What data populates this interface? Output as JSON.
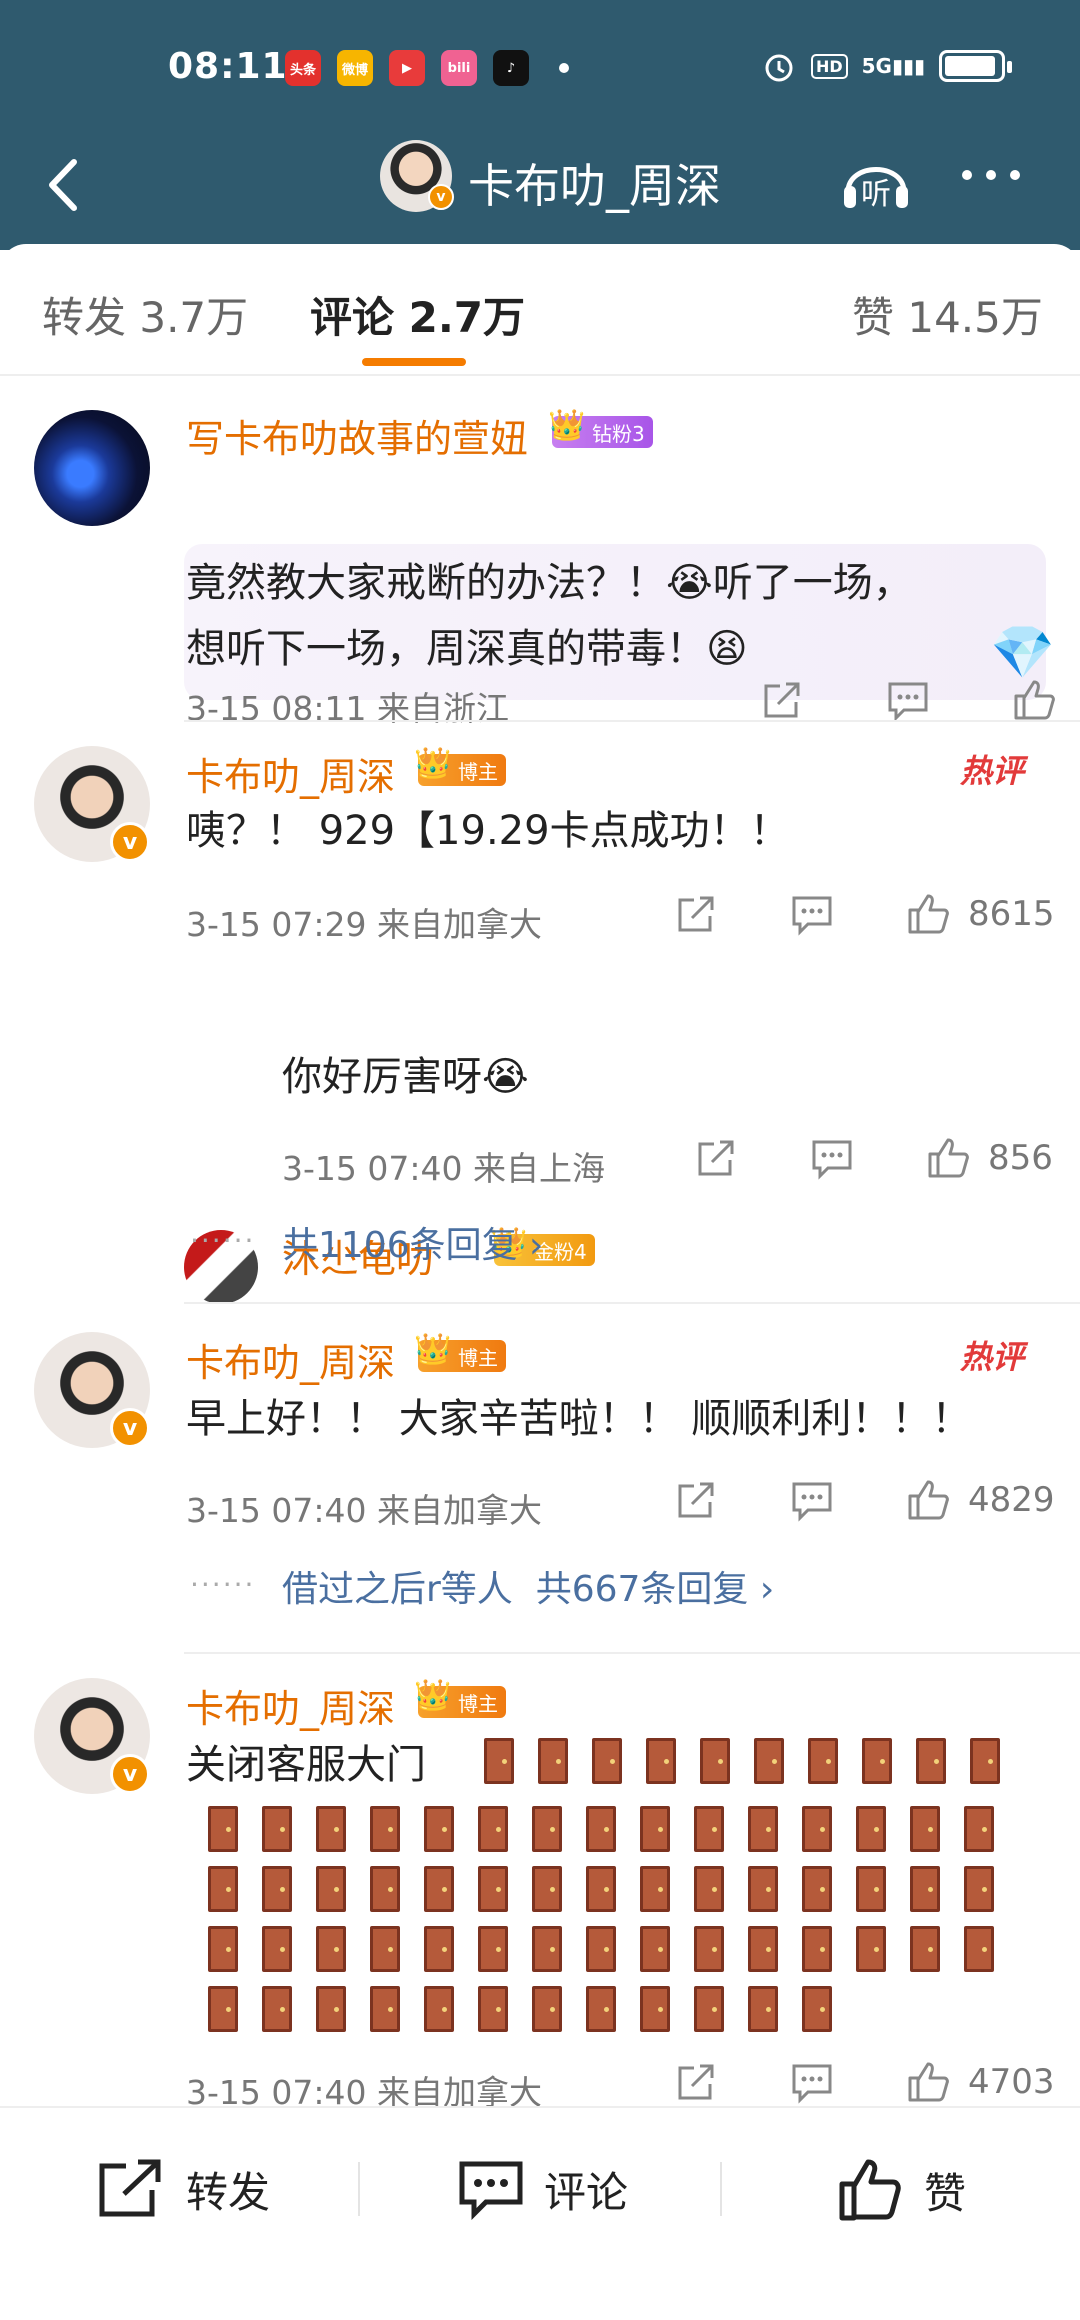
{
  "status": {
    "time": "08:11",
    "app_icons": [
      "头条",
      "微博",
      "▶",
      "bili",
      "♪"
    ],
    "net": "5G",
    "hd": "HD"
  },
  "nav": {
    "title": "卡布叻_周深"
  },
  "tabs": [
    {
      "label": "转发 3.7万"
    },
    {
      "label": "评论 2.7万"
    },
    {
      "label": "赞 14.5万"
    }
  ],
  "comments": [
    {
      "name": "写卡布叻故事的萱妞",
      "badge": "钻粉3",
      "line1": "竟然教大家戒断的办法？！😭听了一场，",
      "line2": "想听下一场，周深真的带毒！😫",
      "meta": "3-15 08:11  来自浙江"
    },
    {
      "name": "卡布叻_周深",
      "badge": "博主",
      "hot": "热评",
      "text": "咦？！ 929【19.29卡点成功！！",
      "meta": "3-15 07:29  来自加拿大",
      "likes": "8615",
      "reply": {
        "name": "沐尐龟叻",
        "badge": "金粉4",
        "text": "你好厉害呀😭",
        "meta": "3-15 07:40  来自上海",
        "likes": "856"
      },
      "replies_link": "共1106条回复 ›"
    },
    {
      "name": "卡布叻_周深",
      "badge": "博主",
      "hot": "热评",
      "text": "早上好！！ 大家辛苦啦！！ 顺顺利利！！！",
      "meta": "3-15 07:40  来自加拿大",
      "likes": "4829",
      "replied_by": "借过之后r等人",
      "replies_link": "共667条回复 ›"
    },
    {
      "name": "卡布叻_周深",
      "badge": "博主",
      "text": "关闭客服大门",
      "meta": "3-15 07:40  来自加拿大",
      "likes": "4703"
    }
  ],
  "bottom": {
    "repost": "转发",
    "comment": "评论",
    "like": "赞"
  },
  "colors": {
    "header": "#2f5a6e",
    "accent": "#f57c00",
    "name": "#e46e00",
    "link": "#4a6fa0"
  }
}
